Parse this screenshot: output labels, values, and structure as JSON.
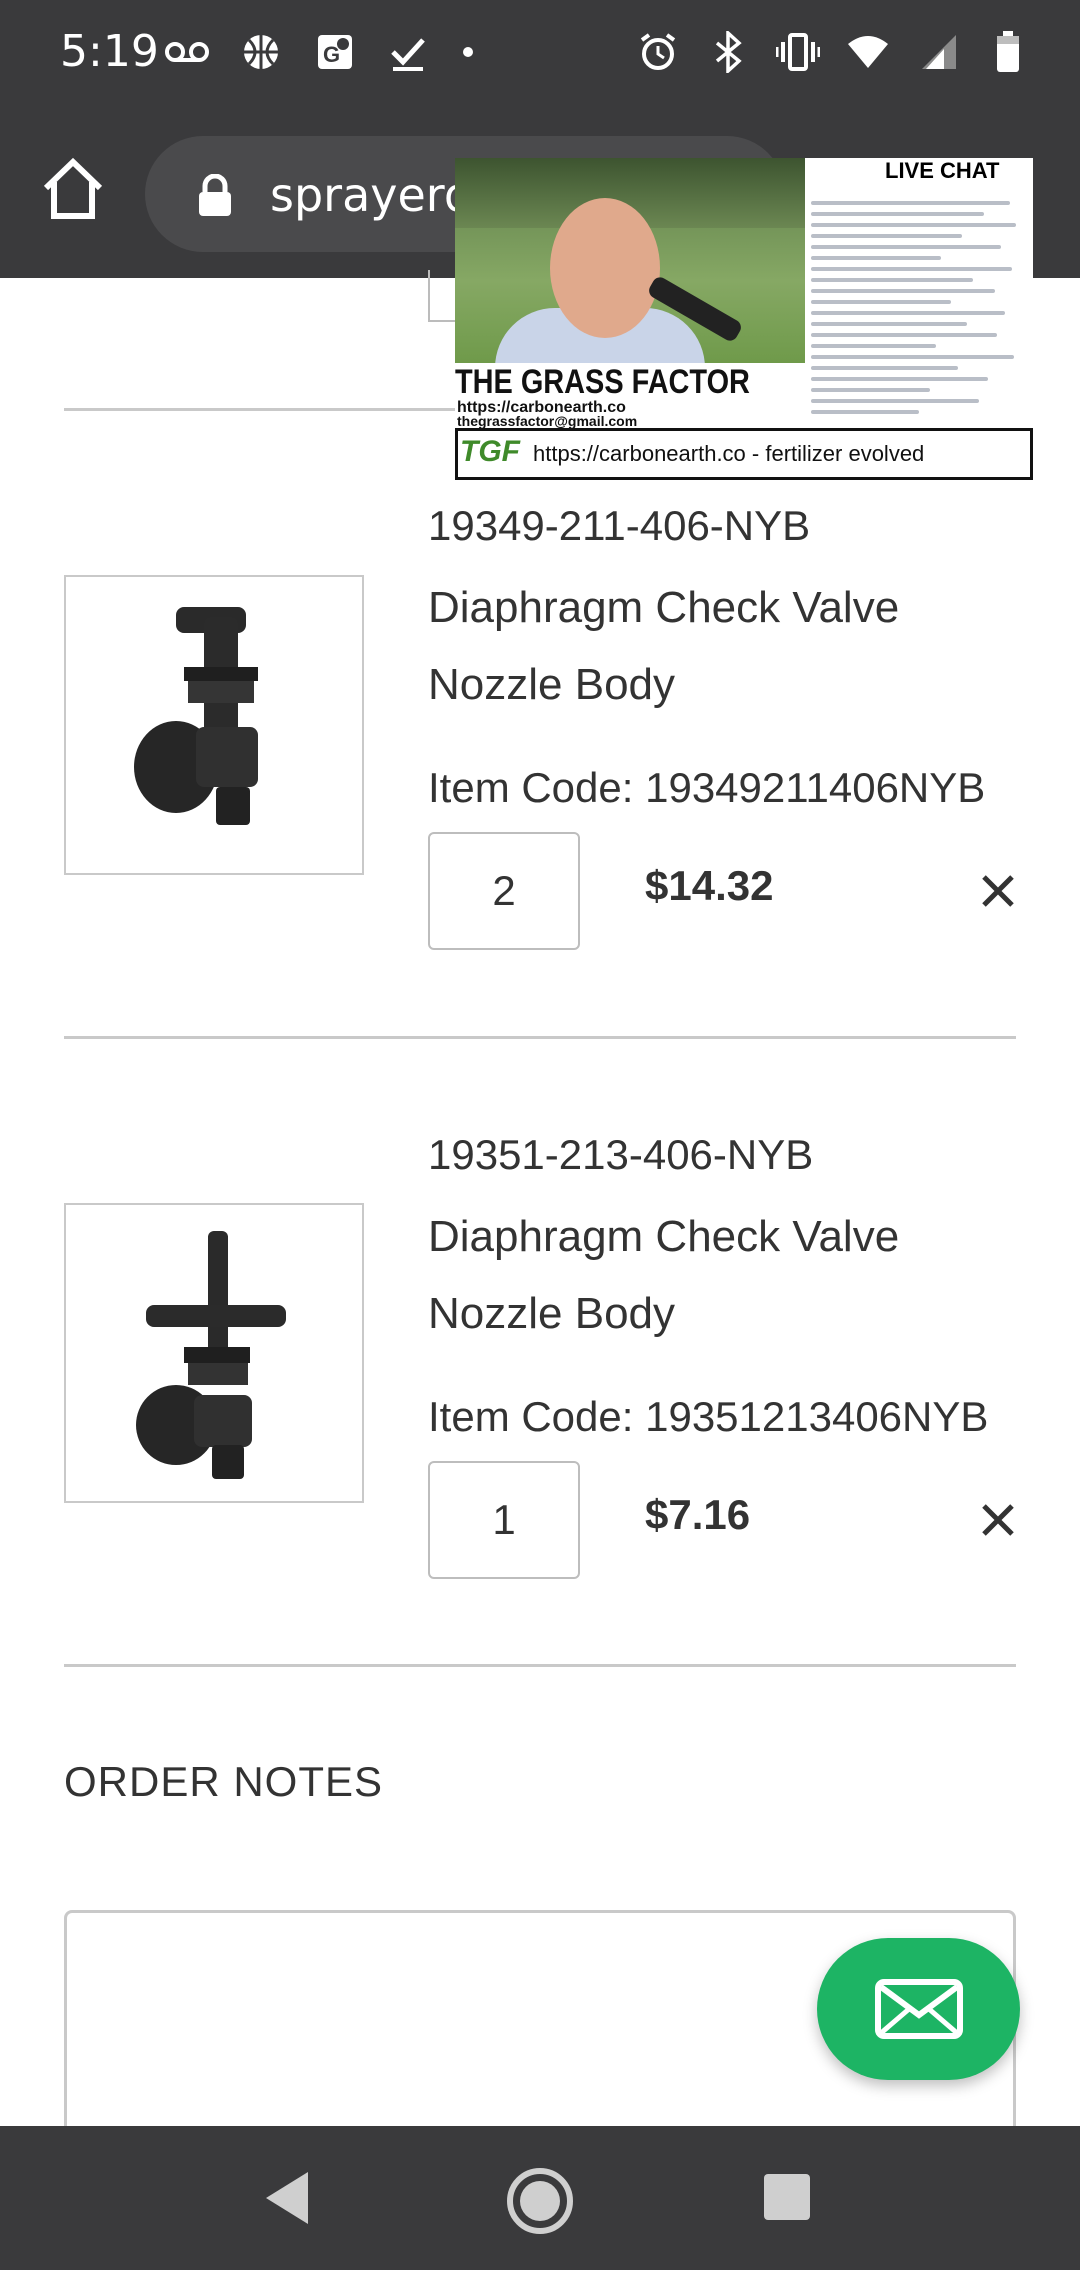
{
  "status_bar": {
    "time": "5:19",
    "left_icons": [
      "voicemail-icon",
      "basketball-icon",
      "maps-icon",
      "task-check-icon",
      "notification-dot-icon"
    ],
    "right_icons": [
      "alarm-icon",
      "bluetooth-icon",
      "vibrate-icon",
      "wifi-icon",
      "signal-icon",
      "battery-icon"
    ]
  },
  "browser": {
    "url_text": "sprayerd"
  },
  "video_overlay": {
    "chat_title": "LIVE CHAT",
    "show_title": "THE GRASS FACTOR",
    "show_url": "https://carbonearth.co",
    "show_email": "thegrassfactor@gmail.com",
    "logo_text": "TGF",
    "banner_text": "https://carbonearth.co - fertilizer evolved"
  },
  "cart": {
    "items": [
      {
        "sku": "19349-211-406-NYB",
        "desc_line1": "Diaphragm Check Valve",
        "desc_line2": "Nozzle Body",
        "item_code": "Item Code: 19349211406NYB",
        "quantity": "2",
        "price": "$14.32"
      },
      {
        "sku": "19351-213-406-NYB",
        "desc_line1": "Diaphragm Check Valve",
        "desc_line2": "Nozzle Body",
        "item_code": "Item Code: 19351213406NYB",
        "quantity": "1",
        "price": "$7.16"
      }
    ]
  },
  "order_notes": {
    "heading": "ORDER NOTES"
  },
  "colors": {
    "chrome": "#3a3a3c",
    "fab_green": "#1db464",
    "text": "#333333",
    "divider": "#c9c9c9"
  }
}
